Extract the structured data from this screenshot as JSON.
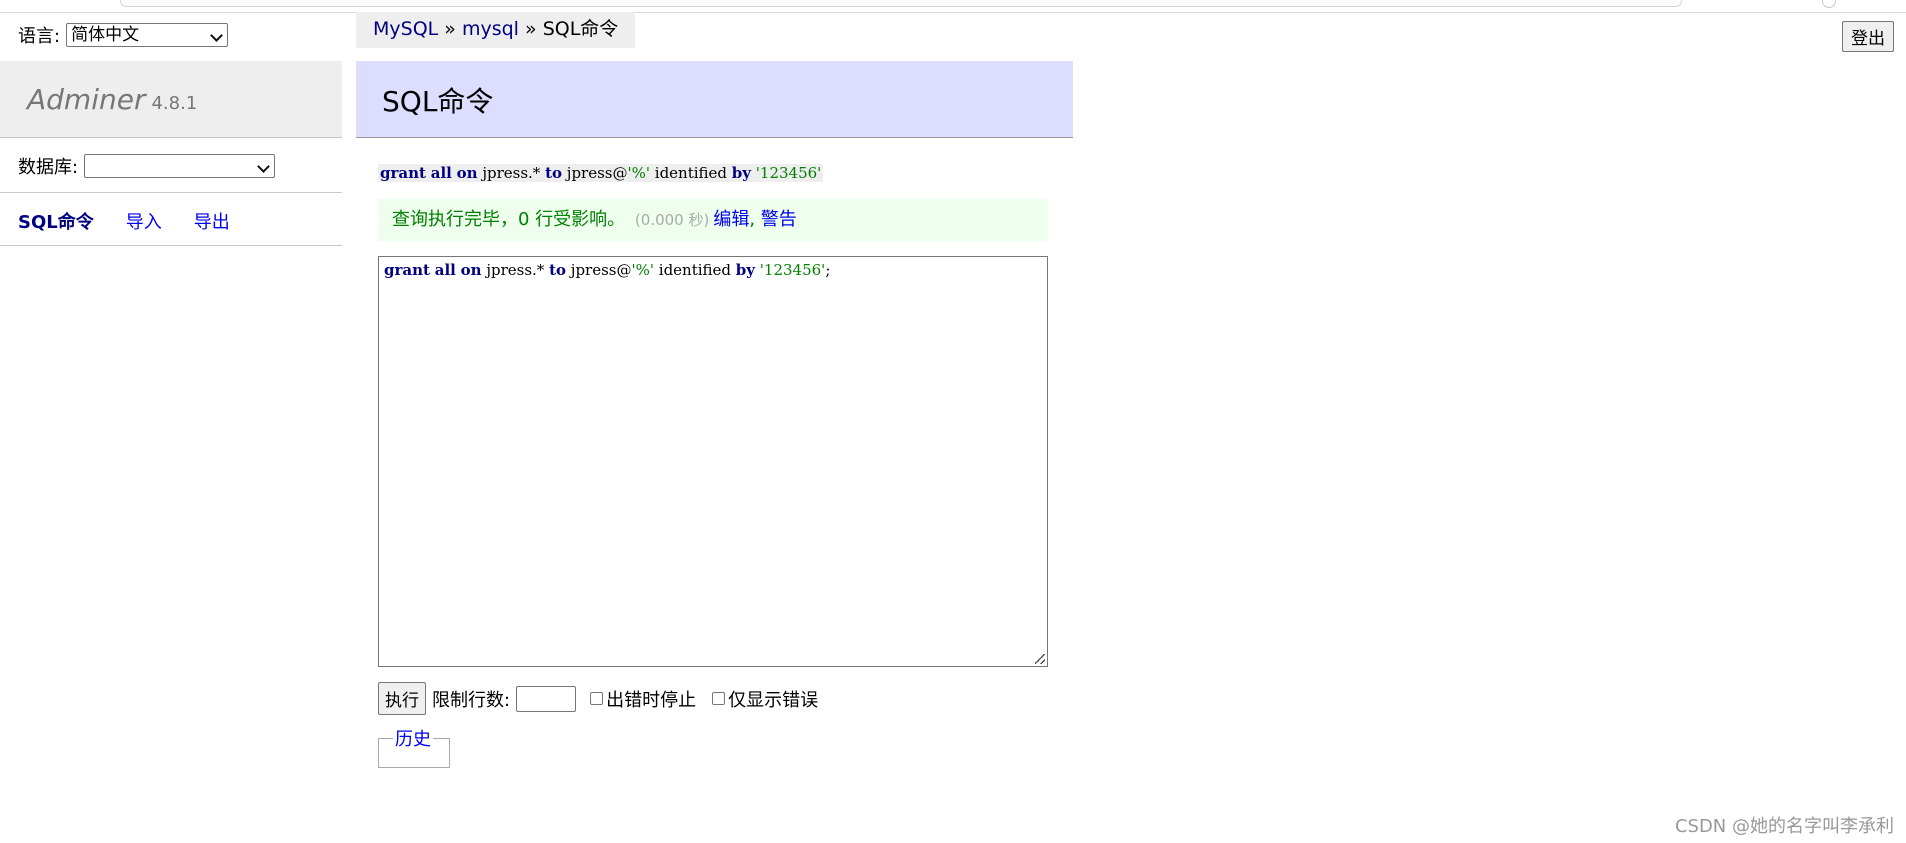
{
  "language": {
    "label": "语言:",
    "selected": "简体中文"
  },
  "logo": {
    "name": "Adminer",
    "version": "4.8.1"
  },
  "database": {
    "label": "数据库:",
    "selected": ""
  },
  "sidebar_links": {
    "sql_command": "SQL命令",
    "import": "导入",
    "export": "导出"
  },
  "breadcrumb": {
    "server": "MySQL",
    "sep1": " » ",
    "database": "mysql",
    "sep2": " » ",
    "current": "SQL命令"
  },
  "logout_label": "登出",
  "page_title": "SQL命令",
  "executed_sql": {
    "grant": "grant",
    "all": "all",
    "on": "on",
    "target": "jpress.* ",
    "to": "to",
    "user": "jpress@",
    "host": "'%'",
    "identified": " identified ",
    "by": "by",
    "password": "'123456'"
  },
  "message": {
    "text": "查询执行完毕，0 行受影响。",
    "time": "(0.000 秒)",
    "edit": "编辑",
    "comma": ", ",
    "warnings": "警告"
  },
  "editor": {
    "grant": "grant",
    "all": "all",
    "on": "on",
    "target": "jpress.* ",
    "to": "to",
    "user": "jpress@",
    "host": "'%'",
    "identified": " identified ",
    "by": "by",
    "password": "'123456'",
    "semicolon": ";"
  },
  "controls": {
    "execute_label": "执行",
    "limit_label": "限制行数:",
    "limit_value": "",
    "stop_on_error_label": "出错时停止",
    "only_errors_label": "仅显示错误"
  },
  "history_label": "历史",
  "watermark": "CSDN @她的名字叫李承利"
}
